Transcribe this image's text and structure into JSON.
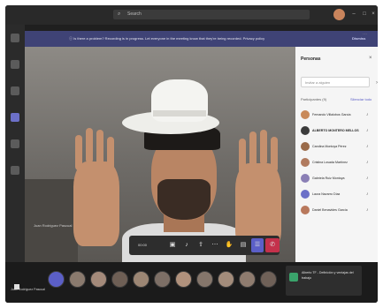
{
  "app": {
    "search_placeholder": "Search"
  },
  "banner": {
    "message": "ⓘ Is there a problem? Recording is in progress. Let everyone in the meeting know that they're being recorded. Privacy policy",
    "dismiss_label": "Dismiss"
  },
  "rail": {
    "items": [
      "Activity",
      "Chat",
      "Teams",
      "Calendar",
      "Calls",
      "Files"
    ]
  },
  "stage": {
    "participant_caption": "Juan Rodriguez Pascual"
  },
  "controls": {
    "timer": "00:00",
    "buttons": [
      "video-icon",
      "mic-icon",
      "share-icon",
      "more-icon",
      "raise-hand-icon",
      "chat-icon",
      "participants-icon",
      "hang-up-icon"
    ]
  },
  "panel": {
    "title": "Personas",
    "invite_placeholder": "Invitar a alguien",
    "section_label": "Participantes (9)",
    "section_action": "Silenciar todo",
    "people": [
      {
        "name": "Fernando Villalobos García",
        "avatar_color": "#c98a5a"
      },
      {
        "name": "ALBERTO MONTERO MELLOS",
        "avatar_color": "#3b3b3b"
      },
      {
        "name": "Carolina Montoya Pérez",
        "avatar_color": "#9a6b4a"
      },
      {
        "name": "Cristina Losada Martínez",
        "avatar_color": "#b07a5e"
      },
      {
        "name": "Gabriela Ruiz Montoya",
        "avatar_color": "#8a7fb5"
      },
      {
        "name": "Laura Navarro Díaz",
        "avatar_color": "#6c70c8"
      },
      {
        "name": "Daniel Benavides García",
        "avatar_color": "#b8785c"
      }
    ]
  },
  "bottom": {
    "label": "Juan Rodriguez Pascual",
    "chat_card": "Alberto TF - Definición y ventajas del trabajo"
  },
  "colors": {
    "accent": "#5b5fc7",
    "hangup": "#c4314b",
    "banner": "#3f4376"
  }
}
